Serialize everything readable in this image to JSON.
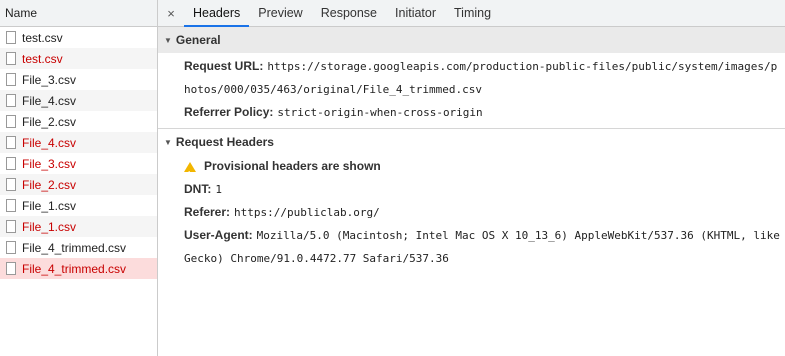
{
  "left": {
    "header": "Name",
    "files": [
      {
        "name": "test.csv",
        "red": false
      },
      {
        "name": "test.csv",
        "red": true
      },
      {
        "name": "File_3.csv",
        "red": false
      },
      {
        "name": "File_4.csv",
        "red": false
      },
      {
        "name": "File_2.csv",
        "red": false
      },
      {
        "name": "File_4.csv",
        "red": true
      },
      {
        "name": "File_3.csv",
        "red": true
      },
      {
        "name": "File_2.csv",
        "red": true
      },
      {
        "name": "File_1.csv",
        "red": false
      },
      {
        "name": "File_1.csv",
        "red": true
      },
      {
        "name": "File_4_trimmed.csv",
        "red": false
      },
      {
        "name": "File_4_trimmed.csv",
        "red": true,
        "selected": true
      }
    ]
  },
  "tabs": {
    "close": "×",
    "items": [
      "Headers",
      "Preview",
      "Response",
      "Initiator",
      "Timing"
    ],
    "active": "Headers"
  },
  "general": {
    "title": "General",
    "request_url_label": "Request URL:",
    "request_url_line1": "https://storage.googleapis.com/production-public-files/public/system/images/p",
    "request_url_line2": "hotos/000/035/463/original/File_4_trimmed.csv",
    "referrer_policy_label": "Referrer Policy:",
    "referrer_policy": "strict-origin-when-cross-origin"
  },
  "request_headers": {
    "title": "Request Headers",
    "warning": "Provisional headers are shown",
    "dnt_label": "DNT:",
    "dnt": "1",
    "referer_label": "Referer:",
    "referer": "https://publiclab.org/",
    "user_agent_label": "User-Agent:",
    "user_agent_line1": "Mozilla/5.0 (Macintosh; Intel Mac OS X 10_13_6) AppleWebKit/537.36 (KHTML, like",
    "user_agent_line2": "Gecko) Chrome/91.0.4472.77 Safari/537.36"
  },
  "colors": {
    "tab_accent": "#1a73e8",
    "error_red": "#c80000",
    "selected_bg": "#fcdcdc",
    "warning_yellow": "#f2b600"
  }
}
